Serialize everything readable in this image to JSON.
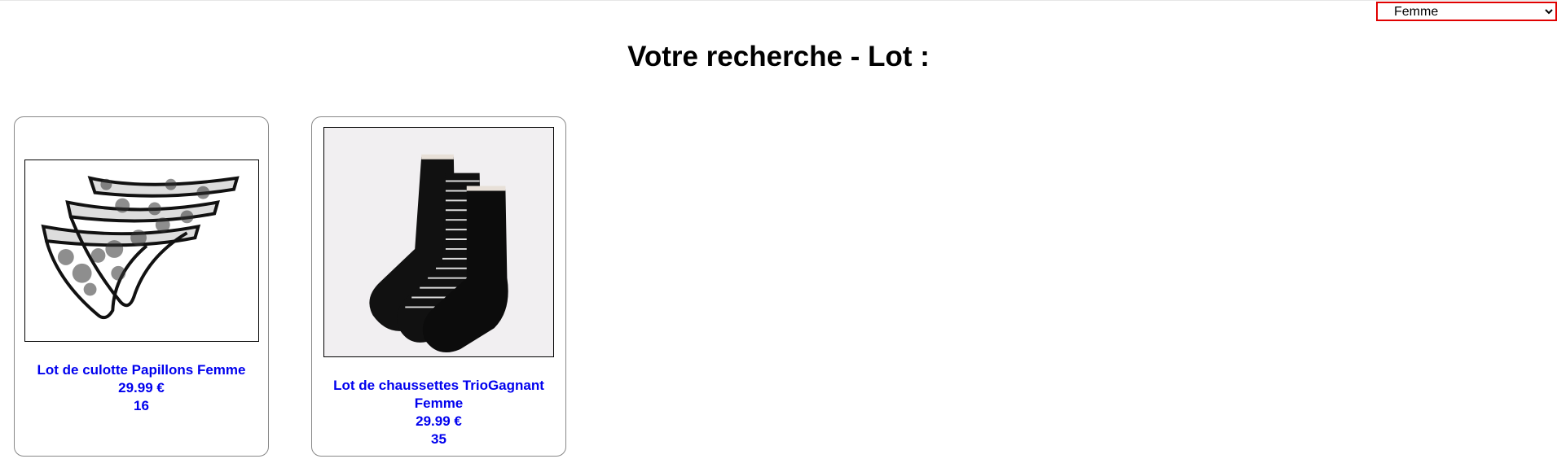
{
  "filter": {
    "selected": "Femme",
    "options": [
      "Femme"
    ]
  },
  "page": {
    "title": "Votre recherche - Lot :"
  },
  "products": [
    {
      "name": "Lot de culotte Papillons Femme",
      "price": "29.99 €",
      "stock": "16",
      "image": "lace-panties-image"
    },
    {
      "name": "Lot de chaussettes TrioGagnant Femme",
      "price": "29.99 €",
      "stock": "35",
      "image": "socks-image"
    }
  ]
}
